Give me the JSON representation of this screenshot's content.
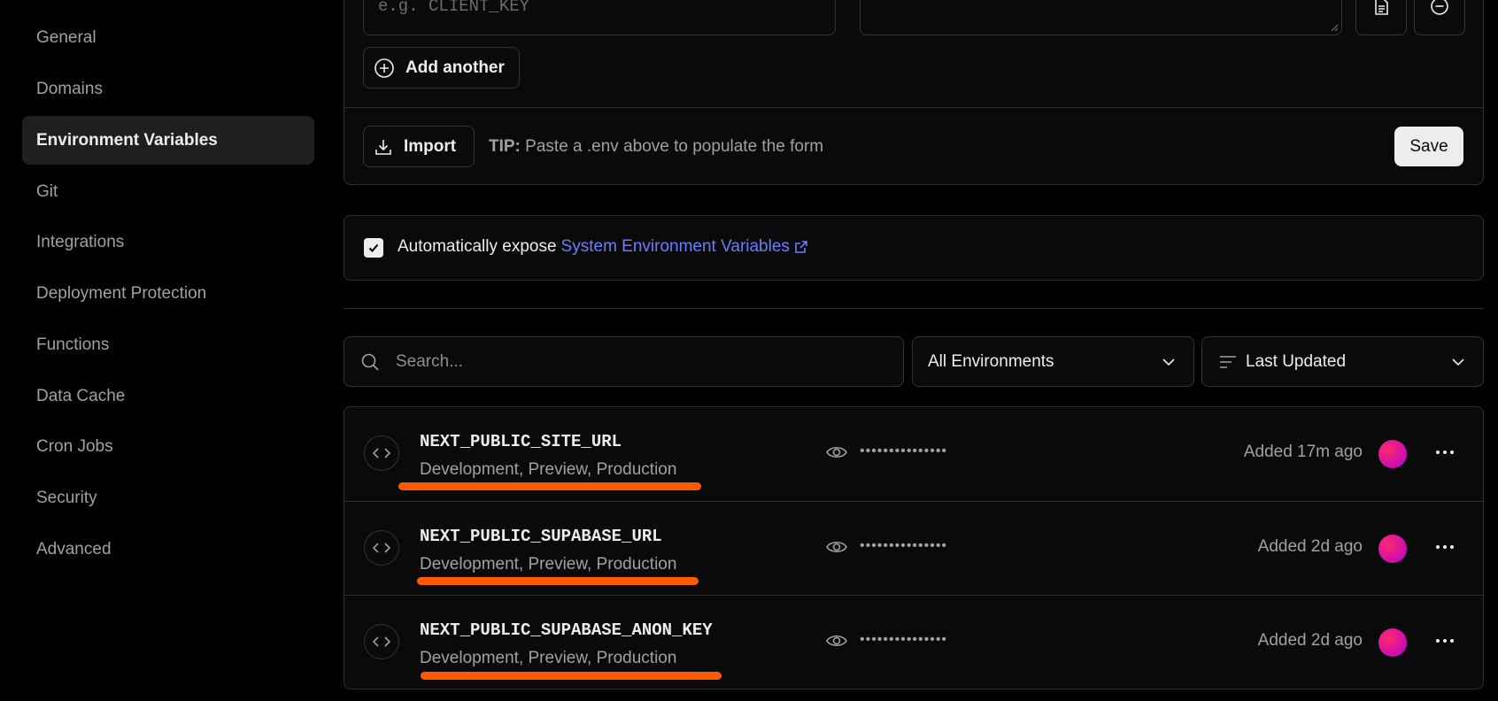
{
  "sidebar": {
    "items": [
      {
        "label": "General"
      },
      {
        "label": "Domains"
      },
      {
        "label": "Environment Variables",
        "active": true
      },
      {
        "label": "Git"
      },
      {
        "label": "Integrations"
      },
      {
        "label": "Deployment Protection"
      },
      {
        "label": "Functions"
      },
      {
        "label": "Data Cache"
      },
      {
        "label": "Cron Jobs"
      },
      {
        "label": "Security"
      },
      {
        "label": "Advanced"
      }
    ]
  },
  "form": {
    "key_placeholder": "e.g. CLIENT_KEY",
    "value_placeholder": "",
    "add_another_label": "Add another",
    "import_label": "Import",
    "tip_prefix": "TIP:",
    "tip_text": "Paste a .env above to populate the form",
    "save_label": "Save"
  },
  "expose": {
    "checked": true,
    "prefix": "Automatically expose",
    "link_text": "System Environment Variables"
  },
  "filters": {
    "search_placeholder": "Search...",
    "environment_select": "All Environments",
    "sort_select": "Last Updated"
  },
  "variables": [
    {
      "name": "NEXT_PUBLIC_SITE_URL",
      "environments": "Development, Preview, Production",
      "masked_value": "•••••••••••••••",
      "added": "Added 17m ago"
    },
    {
      "name": "NEXT_PUBLIC_SUPABASE_URL",
      "environments": "Development, Preview, Production",
      "masked_value": "•••••••••••••••",
      "added": "Added 2d ago"
    },
    {
      "name": "NEXT_PUBLIC_SUPABASE_ANON_KEY",
      "environments": "Development, Preview, Production",
      "masked_value": "•••••••••••••••",
      "added": "Added 2d ago"
    }
  ],
  "colors": {
    "accent_link": "#6d7cff",
    "highlight_underline": "#ff5a00",
    "active_nav_bg": "#1f1f1f"
  }
}
